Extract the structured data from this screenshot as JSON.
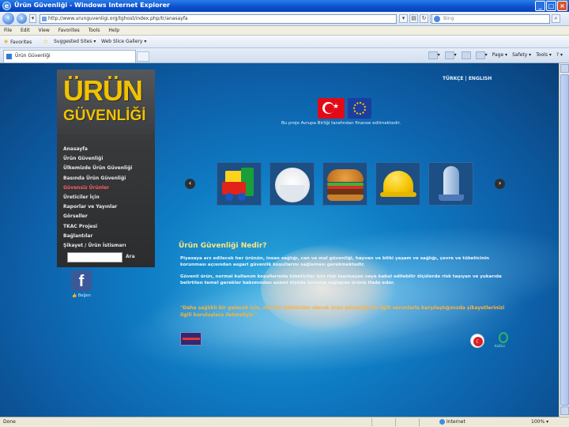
{
  "window": {
    "title": "Ürün Güvenliği - Windows Internet Explorer"
  },
  "address": {
    "url": "http://www.urunguvenligi.org/tghost/index.php/tr/anasayfa",
    "search_placeholder": "Bing"
  },
  "menubar": [
    "File",
    "Edit",
    "View",
    "Favorites",
    "Tools",
    "Help"
  ],
  "favorites": {
    "favorites_label": "Favorites",
    "suggested_sites": "Suggested Sites",
    "web_slice": "Web Slice Gallery"
  },
  "tab": {
    "title": "Ürün Güvenliği"
  },
  "commandbar": {
    "page": "Page",
    "safety": "Safety",
    "tools": "Tools"
  },
  "site": {
    "logo_line1": "ÜRÜN",
    "logo_line2": "GÜVENLİĞİ",
    "language": "TÜRKÇE | ENGLISH",
    "eu_caption": "Bu proje Avrupa Birliği tarafından finanse edilmektedir.",
    "menu": [
      "Anasayfa",
      "Ürün Güvenliği",
      "Ülkemizde Ürün Güvenliği",
      "Basında Ürün Güvenliği",
      "Güvensiz Ürünler",
      "Üreticiler İçin",
      "Raporlar ve Yayınlar",
      "Görseller",
      "TKAC Projesi",
      "Bağlantılar",
      "Şikayet / Ürün İstismarı"
    ],
    "search_button": "Ara",
    "facebook_like": "Beğen",
    "section_title": "Ürün Güvenliği Nedir?",
    "paragraph1": "Piyasaya arz edilecek her ürünün, insan sağlığı, can ve mal güvenliği, hayvan ve bitki yaşam ve sağlığı, çevre ve tüketicinin korunması açısından asgari güvenlik koşullarını sağlaması gerekmektedir.",
    "paragraph2": "Güvenli ürün, normal kullanım koşullarında tüketiciler için risk taşımayan veya kabul edilebilir ölçülerde risk taşıyan ve yukarıda belirtilen temel gerekler bakımından azami ölçüde koruma sağlayan ürünü ifade eder.",
    "quote": "\"Daha sağlıklı bir gelecek için, duyarlı tüketiciler olarak ürün güvenliği ile ilgili sorunlarla karşılaştığınızda şikayetlerinizi ilgili kuruluşlara iletmeliyiz.\"",
    "badge_q_label": "KalDer"
  },
  "status": {
    "text": "Done",
    "zone": "Internet",
    "zoom": "100%"
  },
  "colors": {
    "accent_yellow": "#f2c200",
    "active_menu": "#ff5a66",
    "quote": "#ffb23a"
  }
}
